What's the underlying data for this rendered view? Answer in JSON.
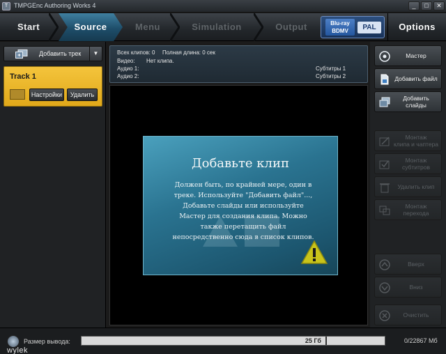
{
  "window": {
    "title": "TMPGEnc Authoring Works 4",
    "controls": [
      "_",
      "□",
      "✕"
    ]
  },
  "nav": {
    "steps": [
      "Start",
      "Source",
      "Menu",
      "Simulation",
      "Output"
    ],
    "active": "Source",
    "disc_type": "Blu-ray\nBDMV",
    "region": "PAL",
    "options": "Options"
  },
  "left": {
    "add_track": "Добавить трек",
    "dropdown": "▼",
    "track": {
      "name": "Track 1",
      "settings": "Настройки",
      "delete": "Удалить"
    }
  },
  "info": {
    "total_clips": "Всех клипов: 0",
    "total_length": "Полная длина: 0 сек",
    "video_label": "Видео:",
    "video_value": "Нет клипа.",
    "audio1": "Аудио 1:",
    "audio2": "Аудио 2:",
    "sub1": "Субтитры 1",
    "sub2": "Субтитры 2"
  },
  "message": {
    "title": "Добавьте клип",
    "body": "Должен быть, по крайней мере, один в треке. Используйте \"Добавить файл\"..., Добавьте слайды или используйте Мастер для создания клипа. Можно также перетащить файл непосредственно сюда в список клипов."
  },
  "right": {
    "wizard": "Мастер",
    "add_file": "Добавить файл",
    "add_slides": "Добавить\nслайды",
    "montage_clip": "Монтаж\nклипа и чаптера",
    "montage_subs": "Монтаж\nсубтитров",
    "delete_clip": "Удалить клип",
    "montage_transition": "Монтаж\nперехода",
    "up": "Вверх",
    "down": "Вниз",
    "clear": "Очистить"
  },
  "status": {
    "label": "Размер вывода:",
    "capacity": "25 Гб",
    "count": "0/22867  Мб",
    "fill_fraction": 0,
    "watermark": "wylek"
  }
}
